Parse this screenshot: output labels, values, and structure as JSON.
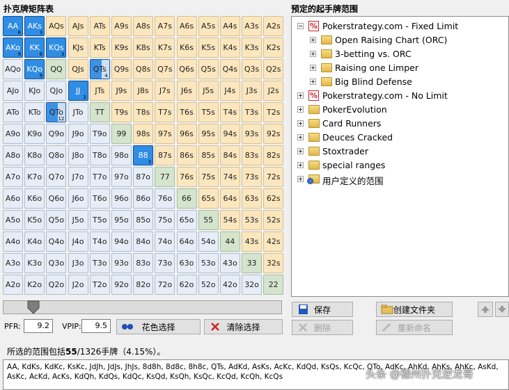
{
  "matrix": {
    "title": "扑克牌矩阵表",
    "rows": [
      [
        {
          "h": "AA",
          "t": "sel",
          "n": "6"
        },
        {
          "h": "AKs",
          "t": "sel",
          "n": "3"
        },
        {
          "h": "AQs",
          "t": "suited"
        },
        {
          "h": "AJs",
          "t": "suited"
        },
        {
          "h": "ATs",
          "t": "suited"
        },
        {
          "h": "A9s",
          "t": "suited"
        },
        {
          "h": "A8s",
          "t": "suited"
        },
        {
          "h": "A7s",
          "t": "suited"
        },
        {
          "h": "A6s",
          "t": "suited"
        },
        {
          "h": "A5s",
          "t": "suited"
        },
        {
          "h": "A4s",
          "t": "suited"
        },
        {
          "h": "A3s",
          "t": "suited"
        },
        {
          "h": "A2s",
          "t": "suited"
        }
      ],
      [
        {
          "h": "AKo",
          "t": "sel",
          "n": "9"
        },
        {
          "h": "KK",
          "t": "sel",
          "n": "6"
        },
        {
          "h": "KQs",
          "t": "sel",
          "n": "3"
        },
        {
          "h": "KJs",
          "t": "suited"
        },
        {
          "h": "KTs",
          "t": "suited"
        },
        {
          "h": "K9s",
          "t": "suited"
        },
        {
          "h": "K8s",
          "t": "suited"
        },
        {
          "h": "K7s",
          "t": "suited"
        },
        {
          "h": "K6s",
          "t": "suited"
        },
        {
          "h": "K5s",
          "t": "suited"
        },
        {
          "h": "K4s",
          "t": "suited"
        },
        {
          "h": "K3s",
          "t": "suited"
        },
        {
          "h": "K2s",
          "t": "suited"
        }
      ],
      [
        {
          "h": "AQo",
          "t": "offsuit"
        },
        {
          "h": "KQo",
          "t": "sel",
          "n": "9"
        },
        {
          "h": "QQ",
          "t": "pair"
        },
        {
          "h": "QJs",
          "t": "suited"
        },
        {
          "h": "QTs",
          "t": "part",
          "n": "4"
        },
        {
          "h": "Q9s",
          "t": "suited"
        },
        {
          "h": "Q8s",
          "t": "suited"
        },
        {
          "h": "Q7s",
          "t": "suited"
        },
        {
          "h": "Q6s",
          "t": "suited"
        },
        {
          "h": "Q5s",
          "t": "suited"
        },
        {
          "h": "Q4s",
          "t": "suited"
        },
        {
          "h": "Q3s",
          "t": "suited"
        },
        {
          "h": "Q2s",
          "t": "suited"
        }
      ],
      [
        {
          "h": "AJo",
          "t": "offsuit"
        },
        {
          "h": "KJo",
          "t": "offsuit"
        },
        {
          "h": "QJo",
          "t": "offsuit"
        },
        {
          "h": "JJ",
          "t": "sel",
          "n": "3"
        },
        {
          "h": "JTs",
          "t": "suited"
        },
        {
          "h": "J9s",
          "t": "suited"
        },
        {
          "h": "J8s",
          "t": "suited"
        },
        {
          "h": "J7s",
          "t": "suited"
        },
        {
          "h": "J6s",
          "t": "suited"
        },
        {
          "h": "J5s",
          "t": "suited"
        },
        {
          "h": "J4s",
          "t": "suited"
        },
        {
          "h": "J3s",
          "t": "suited"
        },
        {
          "h": "J2s",
          "t": "suited"
        }
      ],
      [
        {
          "h": "ATo",
          "t": "offsuit"
        },
        {
          "h": "KTo",
          "t": "offsuit"
        },
        {
          "h": "QTo",
          "t": "part",
          "n": "12"
        },
        {
          "h": "JTo",
          "t": "offsuit"
        },
        {
          "h": "TT",
          "t": "pair"
        },
        {
          "h": "T9s",
          "t": "suited"
        },
        {
          "h": "T8s",
          "t": "suited"
        },
        {
          "h": "T7s",
          "t": "suited"
        },
        {
          "h": "T6s",
          "t": "suited"
        },
        {
          "h": "T5s",
          "t": "suited"
        },
        {
          "h": "T4s",
          "t": "suited"
        },
        {
          "h": "T3s",
          "t": "suited"
        },
        {
          "h": "T2s",
          "t": "suited"
        }
      ],
      [
        {
          "h": "A9o",
          "t": "offsuit"
        },
        {
          "h": "K9o",
          "t": "offsuit"
        },
        {
          "h": "Q9o",
          "t": "offsuit"
        },
        {
          "h": "J9o",
          "t": "offsuit"
        },
        {
          "h": "T9o",
          "t": "offsuit"
        },
        {
          "h": "99",
          "t": "pair"
        },
        {
          "h": "98s",
          "t": "suited"
        },
        {
          "h": "97s",
          "t": "suited"
        },
        {
          "h": "96s",
          "t": "suited"
        },
        {
          "h": "95s",
          "t": "suited"
        },
        {
          "h": "94s",
          "t": "suited"
        },
        {
          "h": "93s",
          "t": "suited"
        },
        {
          "h": "92s",
          "t": "suited"
        }
      ],
      [
        {
          "h": "A8o",
          "t": "offsuit"
        },
        {
          "h": "K8o",
          "t": "offsuit"
        },
        {
          "h": "Q8o",
          "t": "offsuit"
        },
        {
          "h": "J8o",
          "t": "offsuit"
        },
        {
          "h": "T8o",
          "t": "offsuit"
        },
        {
          "h": "98o",
          "t": "offsuit"
        },
        {
          "h": "88",
          "t": "sel",
          "n": "3"
        },
        {
          "h": "87s",
          "t": "suited"
        },
        {
          "h": "86s",
          "t": "suited"
        },
        {
          "h": "85s",
          "t": "suited"
        },
        {
          "h": "84s",
          "t": "suited"
        },
        {
          "h": "83s",
          "t": "suited"
        },
        {
          "h": "82s",
          "t": "suited"
        }
      ],
      [
        {
          "h": "A7o",
          "t": "offsuit"
        },
        {
          "h": "K7o",
          "t": "offsuit"
        },
        {
          "h": "Q7o",
          "t": "offsuit"
        },
        {
          "h": "J7o",
          "t": "offsuit"
        },
        {
          "h": "T7o",
          "t": "offsuit"
        },
        {
          "h": "97o",
          "t": "offsuit"
        },
        {
          "h": "87o",
          "t": "offsuit"
        },
        {
          "h": "77",
          "t": "pair"
        },
        {
          "h": "76s",
          "t": "suited"
        },
        {
          "h": "75s",
          "t": "suited"
        },
        {
          "h": "74s",
          "t": "suited"
        },
        {
          "h": "73s",
          "t": "suited"
        },
        {
          "h": "72s",
          "t": "suited"
        }
      ],
      [
        {
          "h": "A6o",
          "t": "offsuit"
        },
        {
          "h": "K6o",
          "t": "offsuit"
        },
        {
          "h": "Q6o",
          "t": "offsuit"
        },
        {
          "h": "J6o",
          "t": "offsuit"
        },
        {
          "h": "T6o",
          "t": "offsuit"
        },
        {
          "h": "96o",
          "t": "offsuit"
        },
        {
          "h": "86o",
          "t": "offsuit"
        },
        {
          "h": "76o",
          "t": "offsuit"
        },
        {
          "h": "66",
          "t": "pair"
        },
        {
          "h": "65s",
          "t": "suited"
        },
        {
          "h": "64s",
          "t": "suited"
        },
        {
          "h": "63s",
          "t": "suited"
        },
        {
          "h": "62s",
          "t": "suited"
        }
      ],
      [
        {
          "h": "A5o",
          "t": "offsuit"
        },
        {
          "h": "K5o",
          "t": "offsuit"
        },
        {
          "h": "Q5o",
          "t": "offsuit"
        },
        {
          "h": "J5o",
          "t": "offsuit"
        },
        {
          "h": "T5o",
          "t": "offsuit"
        },
        {
          "h": "95o",
          "t": "offsuit"
        },
        {
          "h": "85o",
          "t": "offsuit"
        },
        {
          "h": "75o",
          "t": "offsuit"
        },
        {
          "h": "65o",
          "t": "offsuit"
        },
        {
          "h": "55",
          "t": "pair"
        },
        {
          "h": "54s",
          "t": "suited"
        },
        {
          "h": "53s",
          "t": "suited"
        },
        {
          "h": "52s",
          "t": "suited"
        }
      ],
      [
        {
          "h": "A4o",
          "t": "offsuit"
        },
        {
          "h": "K4o",
          "t": "offsuit"
        },
        {
          "h": "Q4o",
          "t": "offsuit"
        },
        {
          "h": "J4o",
          "t": "offsuit"
        },
        {
          "h": "T4o",
          "t": "offsuit"
        },
        {
          "h": "94o",
          "t": "offsuit"
        },
        {
          "h": "84o",
          "t": "offsuit"
        },
        {
          "h": "74o",
          "t": "offsuit"
        },
        {
          "h": "64o",
          "t": "offsuit"
        },
        {
          "h": "54o",
          "t": "offsuit"
        },
        {
          "h": "44",
          "t": "pair"
        },
        {
          "h": "43s",
          "t": "suited"
        },
        {
          "h": "42s",
          "t": "suited"
        }
      ],
      [
        {
          "h": "A3o",
          "t": "offsuit"
        },
        {
          "h": "K3o",
          "t": "offsuit"
        },
        {
          "h": "Q3o",
          "t": "offsuit"
        },
        {
          "h": "J3o",
          "t": "offsuit"
        },
        {
          "h": "T3o",
          "t": "offsuit"
        },
        {
          "h": "93o",
          "t": "offsuit"
        },
        {
          "h": "83o",
          "t": "offsuit"
        },
        {
          "h": "73o",
          "t": "offsuit"
        },
        {
          "h": "63o",
          "t": "offsuit"
        },
        {
          "h": "53o",
          "t": "offsuit"
        },
        {
          "h": "43o",
          "t": "offsuit"
        },
        {
          "h": "33",
          "t": "pair"
        },
        {
          "h": "32s",
          "t": "suited"
        }
      ],
      [
        {
          "h": "A2o",
          "t": "offsuit"
        },
        {
          "h": "K2o",
          "t": "offsuit"
        },
        {
          "h": "Q2o",
          "t": "offsuit"
        },
        {
          "h": "J2o",
          "t": "offsuit"
        },
        {
          "h": "T2o",
          "t": "offsuit"
        },
        {
          "h": "92o",
          "t": "offsuit"
        },
        {
          "h": "82o",
          "t": "offsuit"
        },
        {
          "h": "72o",
          "t": "offsuit"
        },
        {
          "h": "62o",
          "t": "offsuit"
        },
        {
          "h": "52o",
          "t": "offsuit"
        },
        {
          "h": "42o",
          "t": "offsuit"
        },
        {
          "h": "32o",
          "t": "offsuit"
        },
        {
          "h": "22",
          "t": "pair"
        }
      ]
    ],
    "colors": {
      "suited": "#fbe6bd",
      "offsuit": "#e6edf6",
      "pair": "#d4e4cd",
      "selected": "#2f8de4"
    }
  },
  "tree": {
    "title": "预定的起手牌范围",
    "nodes": [
      {
        "label": "Pokerstrategy.com - Fixed Limit",
        "icon": "ps-icon",
        "expander": "minus",
        "level": 0
      },
      {
        "label": "Open Raising Chart (ORC)",
        "icon": "folder-icon",
        "expander": "plus",
        "level": 1
      },
      {
        "label": "3-betting vs. ORC",
        "icon": "folder-icon",
        "expander": "plus",
        "level": 1
      },
      {
        "label": "Raising one Limper",
        "icon": "folder-icon",
        "expander": "plus",
        "level": 1
      },
      {
        "label": "Big Blind Defense",
        "icon": "folder-icon",
        "expander": "plus",
        "level": 1
      },
      {
        "label": "Pokerstrategy.com - No Limit",
        "icon": "ps-icon",
        "expander": "plus",
        "level": 0
      },
      {
        "label": "PokerEvolution",
        "icon": "folder-icon",
        "expander": "plus",
        "level": 0
      },
      {
        "label": "Card Runners",
        "icon": "folder-icon",
        "expander": "plus",
        "level": 0
      },
      {
        "label": "Deuces Cracked",
        "icon": "folder-icon",
        "expander": "plus",
        "level": 0
      },
      {
        "label": "Stoxtrader",
        "icon": "folder-icon",
        "expander": "plus",
        "level": 0
      },
      {
        "label": "special ranges",
        "icon": "folder-icon",
        "expander": "plus",
        "level": 0
      },
      {
        "label": "用户定义的范围",
        "icon": "user-folder-icon",
        "expander": "plus",
        "level": 0
      }
    ]
  },
  "controls": {
    "pfr_label": "PFR:",
    "pfr_value": "9.2",
    "vpip_label": "VPIP:",
    "vpip_value": "9.5",
    "suit_select": "花色选择",
    "clear_select": "清除选择",
    "save": "保存",
    "create_folder": "创建文件夹",
    "delete": "删除",
    "rename": "重新命名"
  },
  "status": {
    "prefix": "所选的范围包括",
    "combos": "55",
    "total": "/1326手牌（4.15%）。"
  },
  "combos_text": "AA, KdKs, KdKc, KsKc, JdJh, JdJs, JhJs, 8d8h, 8d8c, 8h8c, QTs, AdKd, AsKs, AcKc, KdQd, KsQs, KcQc, QTo, AdKc, AhKd, AhKs, AhKc, AsKd, AsKc, AcKd, AcKs, KdQh, KdQs, KdQc, KsQd, KsQh, KsQc, KcQd, KcQh, KcQs",
  "watermark": "头条 @德州扑克逆龙哥"
}
